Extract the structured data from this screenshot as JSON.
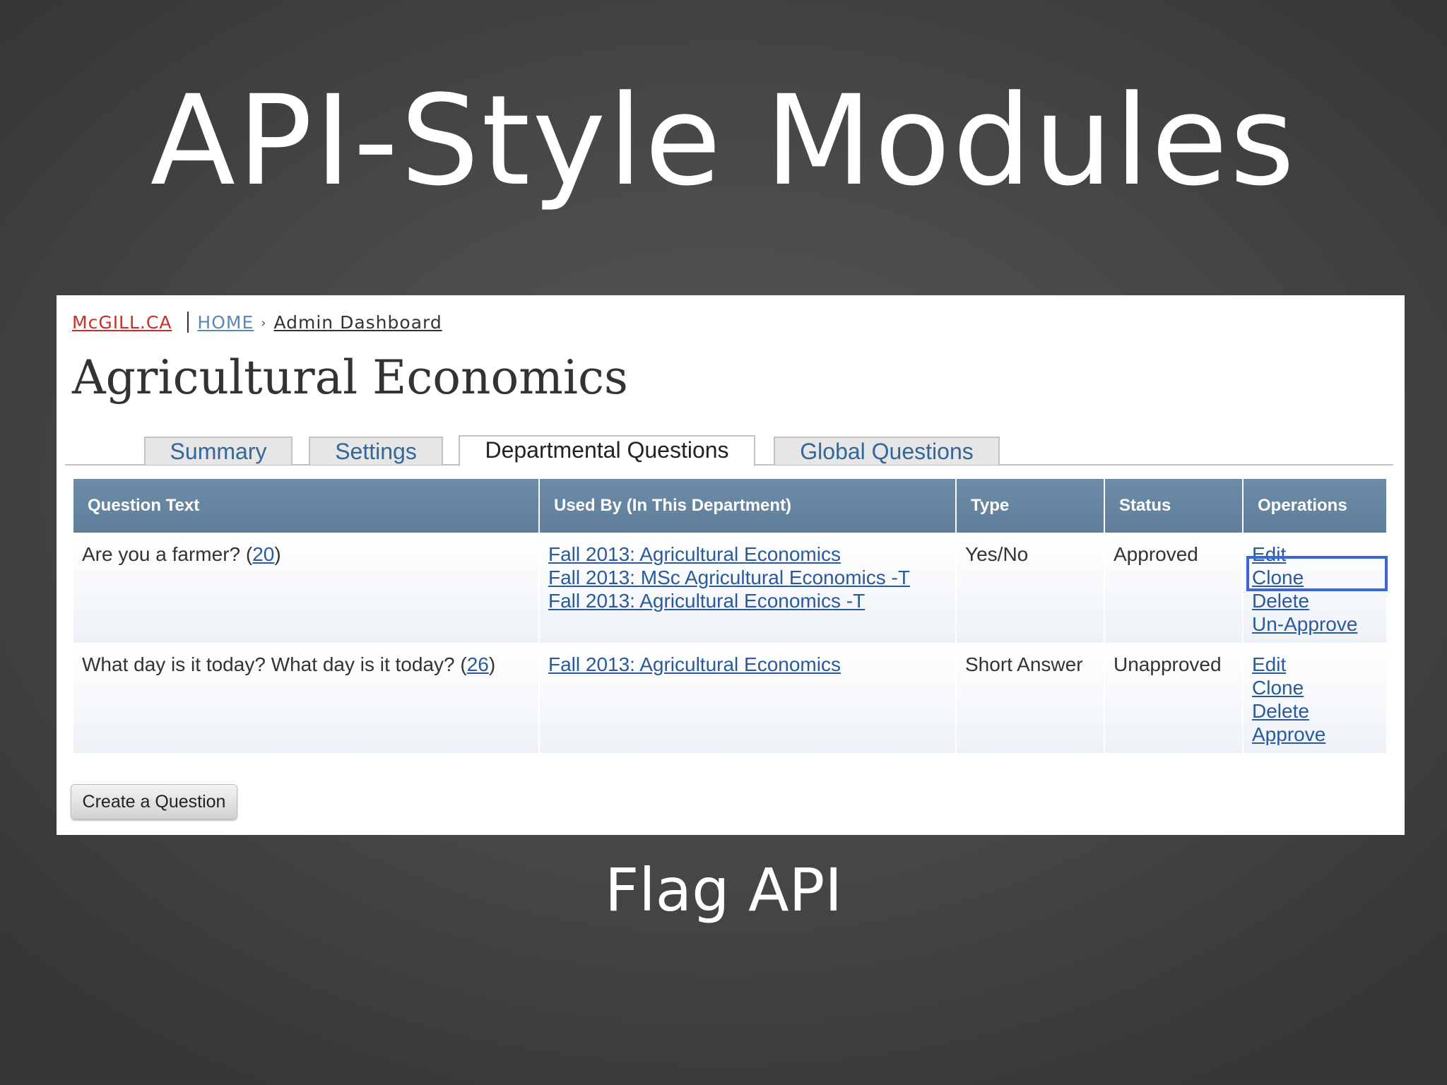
{
  "slide": {
    "title": "API-Style Modules",
    "caption": "Flag API"
  },
  "breadcrumb": {
    "site": "McGILL.CA",
    "home": "HOME",
    "separator": "›",
    "current": "Admin Dashboard"
  },
  "page_title": "Agricultural Economics",
  "tabs": [
    {
      "label": "Summary",
      "active": false
    },
    {
      "label": "Settings",
      "active": false
    },
    {
      "label": "Departmental Questions",
      "active": true
    },
    {
      "label": "Global Questions",
      "active": false
    }
  ],
  "table": {
    "columns": [
      "Question Text",
      "Used By (In This Department)",
      "Type",
      "Status",
      "Operations"
    ],
    "rows": [
      {
        "question": "Are you a farmer?",
        "count_open": "(",
        "count": "20",
        "count_close": ")",
        "used_by": [
          "Fall 2013: Agricultural Economics",
          "Fall 2013: MSc Agricultural Economics -T",
          "Fall 2013: Agricultural Economics -T"
        ],
        "type": "Yes/No",
        "status": "Approved",
        "operations": [
          "Edit",
          "Clone",
          "Delete",
          "Un-Approve"
        ]
      },
      {
        "question": "What day is it today? What day is it today?",
        "count_open": "(",
        "count": "26",
        "count_close": ")",
        "used_by": [
          "Fall 2013: Agricultural Economics"
        ],
        "type": "Short Answer",
        "status": "Unapproved",
        "operations": [
          "Edit",
          "Clone",
          "Delete",
          "Approve"
        ]
      }
    ]
  },
  "create_button": "Create a Question",
  "colors": {
    "table_header": "#6583a0",
    "link": "#2a5a9c",
    "highlight_box": "#3b66d6",
    "site_link": "#c8302a"
  }
}
